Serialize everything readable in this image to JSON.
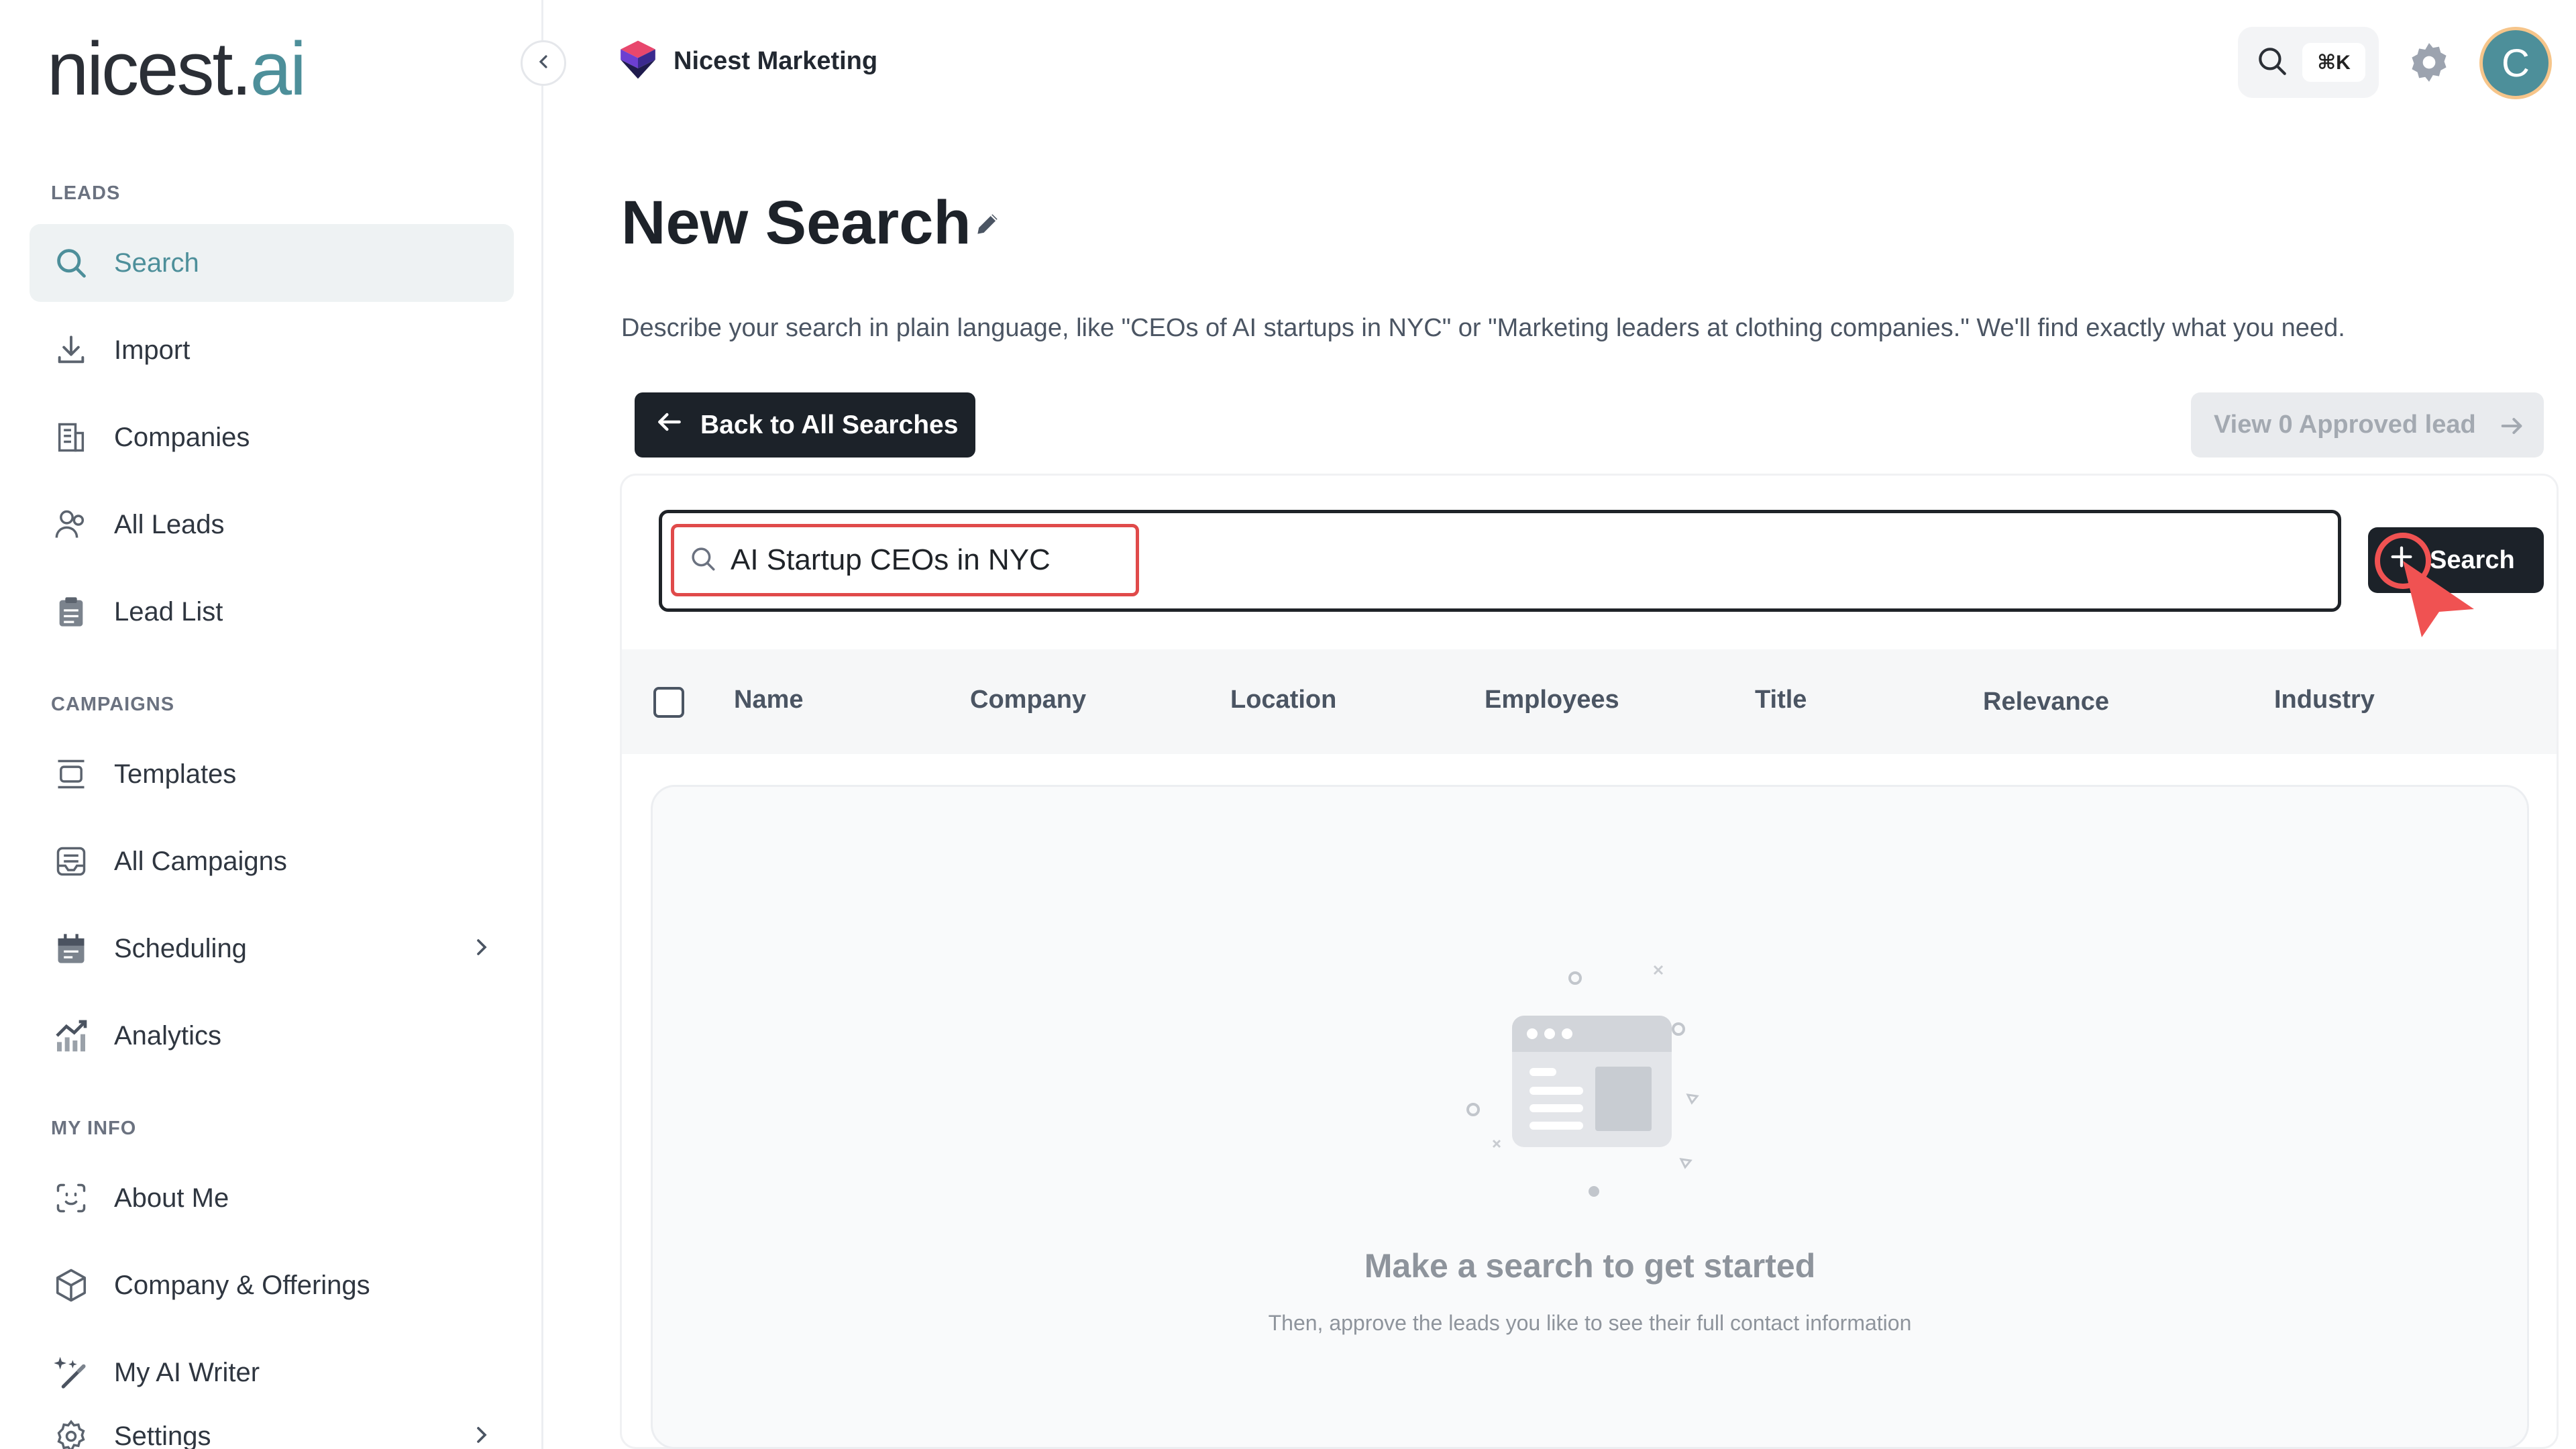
{
  "app": {
    "logo_main": "nicest.",
    "logo_ai": "ai",
    "workspace_name": "Nicest Marketing",
    "avatar_initial": "C",
    "shortcut": "⌘K",
    "accent_color": "#4d8f9a"
  },
  "sidebar": {
    "sections": {
      "leads": "LEADS",
      "campaigns": "CAMPAIGNS",
      "my_info": "MY INFO"
    },
    "items": [
      {
        "label": "Search",
        "icon": "search-icon",
        "active": true
      },
      {
        "label": "Import",
        "icon": "download-icon"
      },
      {
        "label": "Companies",
        "icon": "building-icon"
      },
      {
        "label": "All Leads",
        "icon": "users-icon"
      },
      {
        "label": "Lead List",
        "icon": "clipboard-icon"
      },
      {
        "label": "Templates",
        "icon": "template-icon"
      },
      {
        "label": "All Campaigns",
        "icon": "inbox-icon"
      },
      {
        "label": "Scheduling",
        "icon": "calendar-icon",
        "has_submenu": true
      },
      {
        "label": "Analytics",
        "icon": "chart-icon"
      },
      {
        "label": "About Me",
        "icon": "smile-icon"
      },
      {
        "label": "Company & Offerings",
        "icon": "box-icon"
      },
      {
        "label": "My AI Writer",
        "icon": "sparkle-icon"
      },
      {
        "label": "Settings",
        "icon": "gear-icon",
        "has_submenu": true
      }
    ]
  },
  "main": {
    "title": "New Search",
    "description": "Describe your search in plain language, like \"CEOs of AI startups in NYC\" or \"Marketing leaders at clothing companies.\" We'll find exactly what you need.",
    "back_button": "Back to All Searches",
    "approved_button": "View 0 Approved lead",
    "query_value": "AI Startup CEOs in NYC",
    "search_button": "Search",
    "table_columns": [
      "Name",
      "Company",
      "Location",
      "Employees",
      "Title",
      "Relevance",
      "Industry"
    ],
    "empty_title": "Make a search to get started",
    "empty_subtitle": "Then, approve the leads you like to see their full contact information"
  }
}
